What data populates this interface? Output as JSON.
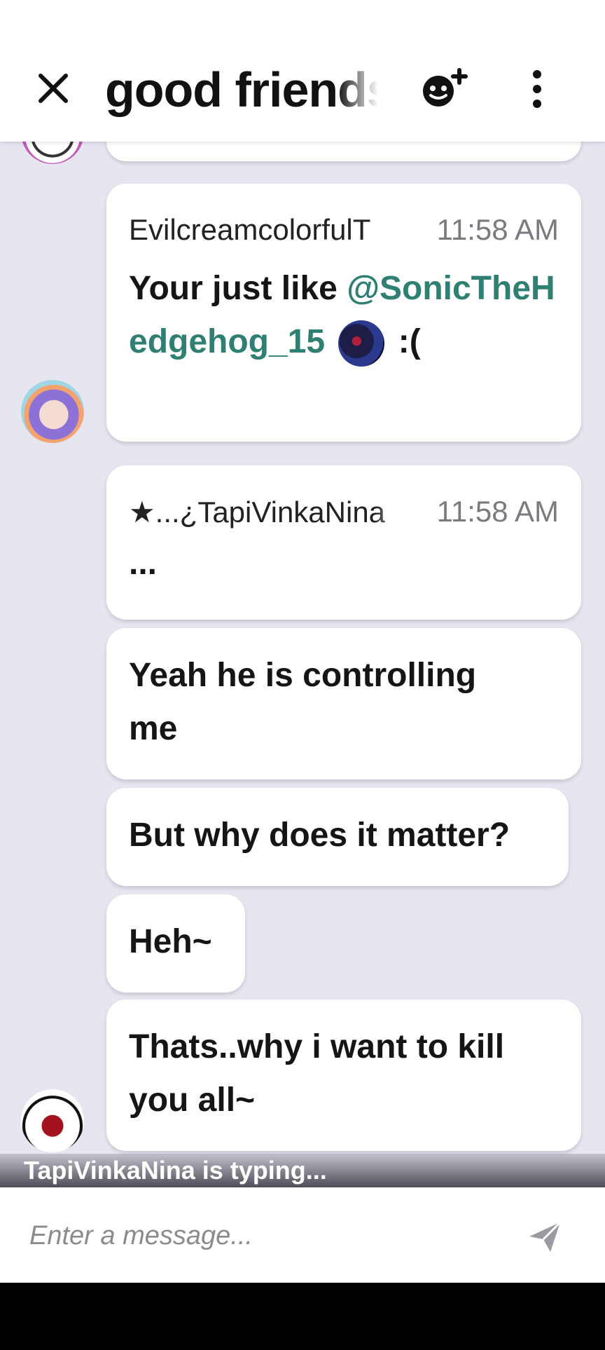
{
  "header": {
    "title": "good friends",
    "close_icon": "close-icon",
    "invite_icon": "add-member-icon",
    "more_icon": "more-vertical-icon"
  },
  "messages": [
    {
      "author": "EvilcreamcolorfulT",
      "time": "11:58 AM",
      "text_prefix": "Your just like ",
      "mention": "@SonicTheHedgehog_15",
      "text_suffix": ":("
    },
    {
      "author": "★...¿TapiVinkaNina",
      "time": "11:58 AM",
      "text": "..."
    },
    {
      "text": "Yeah he is controlling me"
    },
    {
      "text": "But why does it matter?"
    },
    {
      "text": "Heh~"
    },
    {
      "text": "Thats..why i want to kill you all~"
    }
  ],
  "typing": "TapiVinkaNina is typing...",
  "composer": {
    "placeholder": "Enter a message...",
    "send_icon": "send-icon"
  },
  "colors": {
    "background": "#e6e6f0",
    "mention": "#2f7f73",
    "bubble": "#ffffff"
  }
}
